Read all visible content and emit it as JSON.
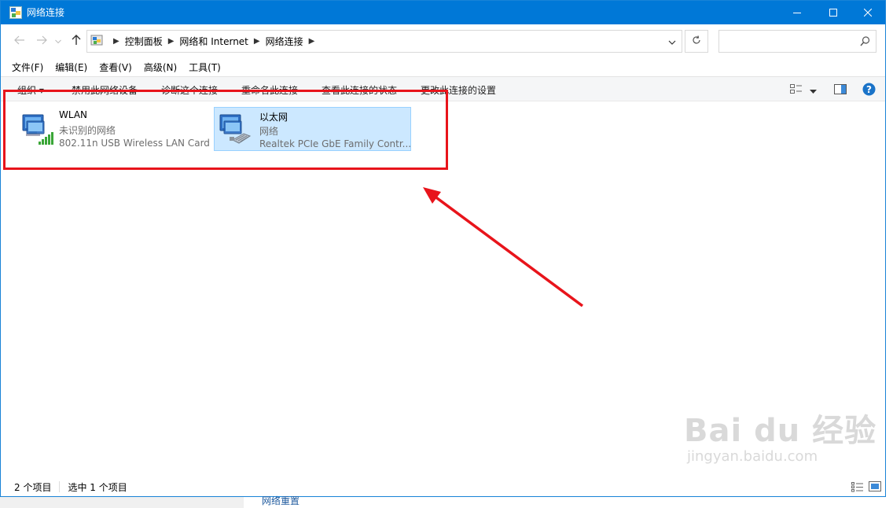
{
  "window": {
    "title": "网络连接",
    "icon": "network-connections-icon",
    "controls": [
      "minimize-icon",
      "maximize-icon",
      "close-icon"
    ]
  },
  "address_bar": {
    "breadcrumbs": [
      "控制面板",
      "网络和 Internet",
      "网络连接"
    ],
    "search_placeholder": ""
  },
  "menu": {
    "items": [
      "文件(F)",
      "编辑(E)",
      "查看(V)",
      "高级(N)",
      "工具(T)"
    ]
  },
  "commands": {
    "items": [
      "组织 ▾",
      "禁用此网络设备",
      "诊断这个连接",
      "重命名此连接",
      "查看此连接的状态",
      "更改此连接的设置"
    ]
  },
  "connections": [
    {
      "name": "WLAN",
      "status": "未识别的网络",
      "device": "802.11n USB Wireless LAN Card",
      "icon": "wlan-adapter-icon",
      "selected": false
    },
    {
      "name": "以太网",
      "status": "网络",
      "device": "Realtek PCIe GbE Family Contr...",
      "icon": "ethernet-adapter-icon",
      "selected": true
    }
  ],
  "status_bar": {
    "item_count": "2 个项目",
    "selected_count": "选中 1 个项目"
  },
  "annotation": {
    "box_color": "#e8141b",
    "arrow_color": "#e8141b"
  },
  "watermark": {
    "main": "Bai du 经验",
    "sub": "jingyan.baidu.com"
  },
  "background_text": "网络重置",
  "colors": {
    "titlebar": "#0078d7",
    "selection": "#cce8ff",
    "selection_border": "#99d1ff",
    "help": "#1a73c8"
  }
}
